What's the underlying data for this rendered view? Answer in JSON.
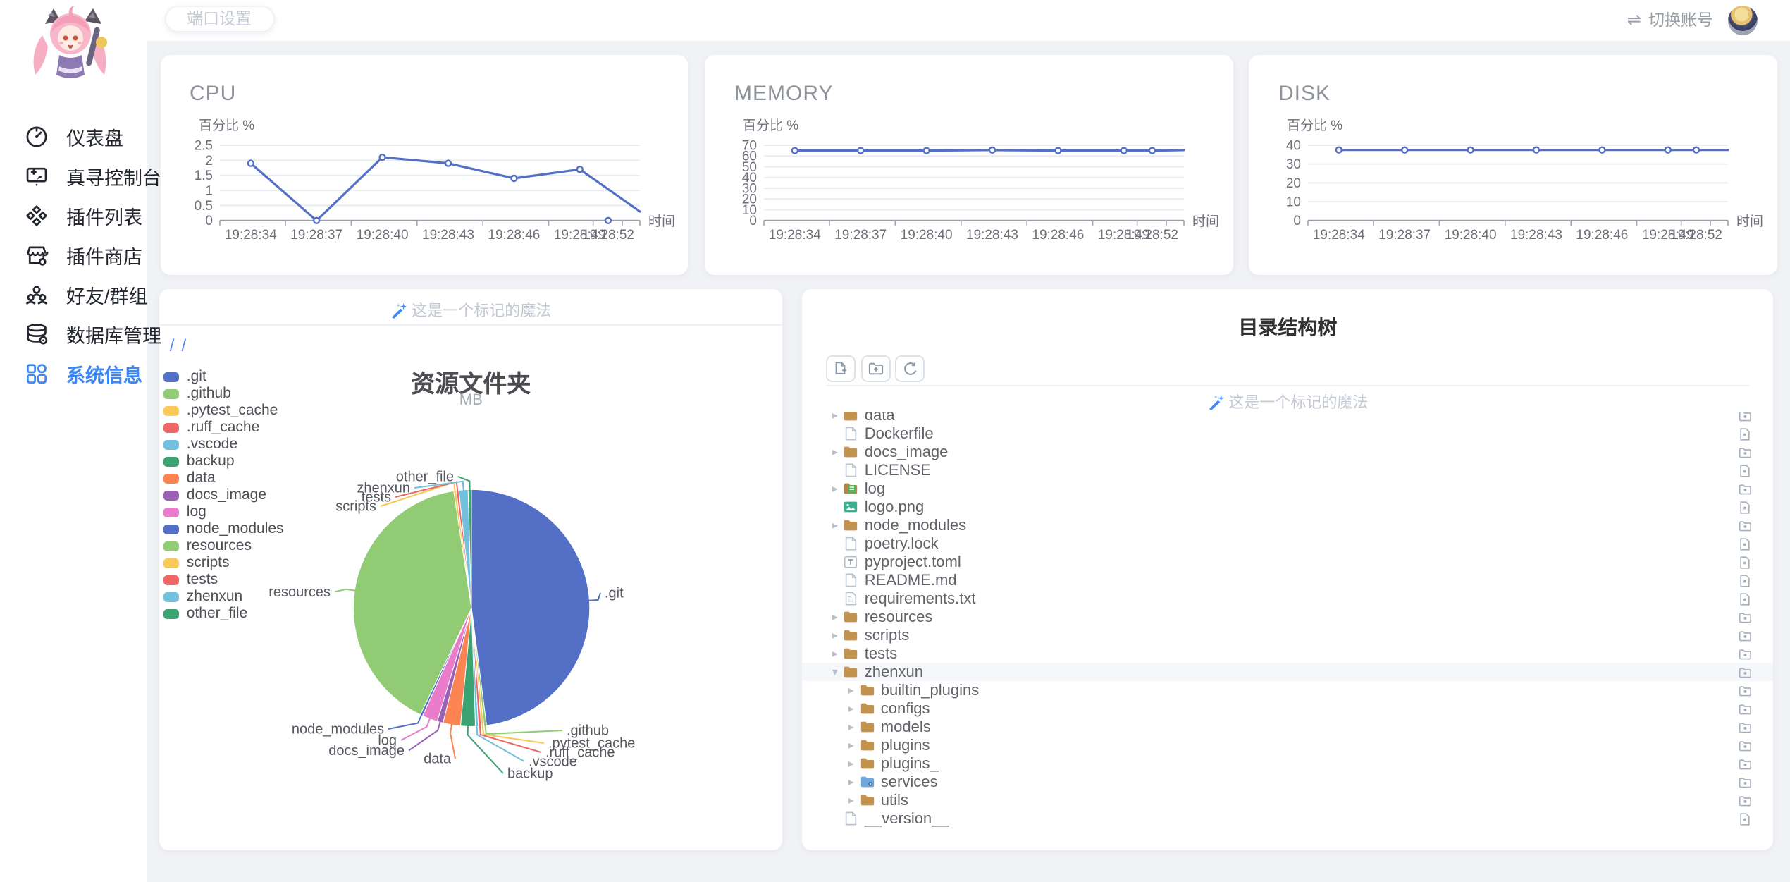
{
  "topbar": {
    "port_button_label": "端口设置",
    "switch_icon": "⇌",
    "switch_account_label": "切换账号"
  },
  "sidebar": {
    "items": [
      {
        "id": "dashboard",
        "label": "仪表盘",
        "active": false
      },
      {
        "id": "console",
        "label": "真寻控制台",
        "active": false
      },
      {
        "id": "plugin-list",
        "label": "插件列表",
        "active": false
      },
      {
        "id": "plugin-store",
        "label": "插件商店",
        "active": false
      },
      {
        "id": "friends-groups",
        "label": "好友/群组",
        "active": false
      },
      {
        "id": "database",
        "label": "数据库管理",
        "active": false
      },
      {
        "id": "system-info",
        "label": "系统信息",
        "active": true
      }
    ]
  },
  "watermark_text": "这是一个标记的魔法",
  "colors": {
    "accent": "#3d87f5",
    "line": "#5470c6",
    "grid": "#e9ecf2",
    "axis": "#9ba1ab"
  },
  "chart_data": [
    {
      "type": "line",
      "title": "CPU",
      "y_axis_name": "百分比 %",
      "x_axis_name": "时间",
      "ylim": [
        0,
        2.5
      ],
      "yticks": [
        0,
        0.5,
        1,
        1.5,
        2,
        2.5
      ],
      "x_labels": [
        "19:28:34",
        "19:28:37",
        "19:28:40",
        "19:28:43",
        "19:28:46",
        "19:28:49",
        "19:28:52"
      ],
      "values": [
        1.9,
        0,
        2.1,
        1.9,
        1.4,
        1.7,
        0,
        0.3
      ],
      "marker_count": 7,
      "detached_index": 6,
      "line_color": "#5470c6",
      "grid": true
    },
    {
      "type": "line",
      "title": "MEMORY",
      "y_axis_name": "百分比 %",
      "x_axis_name": "时间",
      "ylim": [
        0,
        70
      ],
      "yticks": [
        0,
        10,
        20,
        30,
        40,
        50,
        60,
        70
      ],
      "x_labels": [
        "19:28:34",
        "19:28:37",
        "19:28:40",
        "19:28:43",
        "19:28:46",
        "19:28:49",
        "19:28:52"
      ],
      "values": [
        65,
        65,
        65,
        65.5,
        65,
        65,
        65,
        65.5
      ],
      "marker_count": 7,
      "detached_index": null,
      "line_color": "#5470c6",
      "grid": true
    },
    {
      "type": "line",
      "title": "DISK",
      "y_axis_name": "百分比 %",
      "x_axis_name": "时间",
      "ylim": [
        0,
        40
      ],
      "yticks": [
        0,
        10,
        20,
        30,
        40
      ],
      "x_labels": [
        "19:28:34",
        "19:28:37",
        "19:28:40",
        "19:28:43",
        "19:28:46",
        "19:28:49",
        "19:28:52"
      ],
      "values": [
        37.5,
        37.5,
        37.5,
        37.5,
        37.5,
        37.5,
        37.5,
        37.5
      ],
      "marker_count": 7,
      "detached_index": null,
      "line_color": "#5470c6",
      "grid": true
    },
    {
      "type": "pie",
      "title": "资源文件夹",
      "subtitle": "MB",
      "unit": "MB",
      "breadcrumb": [
        "/",
        "/"
      ],
      "legend_position": "left",
      "slices": [
        {
          "name": ".git",
          "color": "#5470c6",
          "value_pct": 48
        },
        {
          "name": ".github",
          "color": "#91cc75",
          "value_pct": 0.35
        },
        {
          "name": ".pytest_cache",
          "color": "#fac858",
          "value_pct": 0.35
        },
        {
          "name": ".ruff_cache",
          "color": "#ee6666",
          "value_pct": 0.4
        },
        {
          "name": ".vscode",
          "color": "#73c0de",
          "value_pct": 0.4
        },
        {
          "name": "backup",
          "color": "#3ba272",
          "value_pct": 2.0
        },
        {
          "name": "data",
          "color": "#fc8452",
          "value_pct": 2.4
        },
        {
          "name": "docs_image",
          "color": "#9a60b4",
          "value_pct": 0.8
        },
        {
          "name": "log",
          "color": "#ea7ccc",
          "value_pct": 2.1
        },
        {
          "name": "node_modules",
          "color": "#5470c6",
          "value_pct": 0.35
        },
        {
          "name": "resources",
          "color": "#91cc75",
          "value_pct": 40.5
        },
        {
          "name": "scripts",
          "color": "#fac858",
          "value_pct": 0.35
        },
        {
          "name": "tests",
          "color": "#ee6666",
          "value_pct": 0.35
        },
        {
          "name": "zhenxun",
          "color": "#73c0de",
          "value_pct": 1.25
        },
        {
          "name": "other_file",
          "color": "#3ba272",
          "value_pct": 0.45
        }
      ]
    }
  ],
  "tree": {
    "title": "目录结构树",
    "toolbar": [
      {
        "id": "new-file",
        "icon": "file-plus-icon"
      },
      {
        "id": "new-folder",
        "icon": "folder-plus-icon"
      },
      {
        "id": "refresh",
        "icon": "refresh-icon"
      }
    ],
    "rows": [
      {
        "name": "data",
        "icon": "folder",
        "type": "folder",
        "level": 0,
        "expanded": false,
        "selected": false
      },
      {
        "name": "Dockerfile",
        "icon": "file",
        "type": "file",
        "level": 0,
        "expanded": false,
        "selected": false
      },
      {
        "name": "docs_image",
        "icon": "folder",
        "type": "folder",
        "level": 0,
        "expanded": false,
        "selected": false
      },
      {
        "name": "LICENSE",
        "icon": "file",
        "type": "file",
        "level": 0,
        "expanded": false,
        "selected": false
      },
      {
        "name": "log",
        "icon": "folder-log",
        "type": "folder",
        "level": 0,
        "expanded": false,
        "selected": false
      },
      {
        "name": "logo.png",
        "icon": "image",
        "type": "file",
        "level": 0,
        "expanded": false,
        "selected": false
      },
      {
        "name": "node_modules",
        "icon": "folder",
        "type": "folder",
        "level": 0,
        "expanded": false,
        "selected": false
      },
      {
        "name": "poetry.lock",
        "icon": "file",
        "type": "file",
        "level": 0,
        "expanded": false,
        "selected": false
      },
      {
        "name": "pyproject.toml",
        "icon": "toml",
        "type": "file",
        "level": 0,
        "expanded": false,
        "selected": false
      },
      {
        "name": "README.md",
        "icon": "file",
        "type": "file",
        "level": 0,
        "expanded": false,
        "selected": false
      },
      {
        "name": "requirements.txt",
        "icon": "txt",
        "type": "file",
        "level": 0,
        "expanded": false,
        "selected": false
      },
      {
        "name": "resources",
        "icon": "folder",
        "type": "folder",
        "level": 0,
        "expanded": false,
        "selected": false
      },
      {
        "name": "scripts",
        "icon": "folder",
        "type": "folder",
        "level": 0,
        "expanded": false,
        "selected": false
      },
      {
        "name": "tests",
        "icon": "folder",
        "type": "folder",
        "level": 0,
        "expanded": false,
        "selected": false
      },
      {
        "name": "zhenxun",
        "icon": "folder",
        "type": "folder",
        "level": 0,
        "expanded": true,
        "selected": true
      },
      {
        "name": "builtin_plugins",
        "icon": "folder",
        "type": "folder",
        "level": 1,
        "expanded": false,
        "selected": false
      },
      {
        "name": "configs",
        "icon": "folder",
        "type": "folder",
        "level": 1,
        "expanded": false,
        "selected": false
      },
      {
        "name": "models",
        "icon": "folder",
        "type": "folder",
        "level": 1,
        "expanded": false,
        "selected": false
      },
      {
        "name": "plugins",
        "icon": "folder",
        "type": "folder",
        "level": 1,
        "expanded": false,
        "selected": false
      },
      {
        "name": "plugins_",
        "icon": "folder",
        "type": "folder",
        "level": 1,
        "expanded": false,
        "selected": false
      },
      {
        "name": "services",
        "icon": "folder-services",
        "type": "folder",
        "level": 1,
        "expanded": false,
        "selected": false
      },
      {
        "name": "utils",
        "icon": "folder",
        "type": "folder",
        "level": 1,
        "expanded": false,
        "selected": false
      },
      {
        "name": "__version__",
        "icon": "file",
        "type": "file",
        "level": 0,
        "expanded": false,
        "selected": false
      }
    ]
  }
}
